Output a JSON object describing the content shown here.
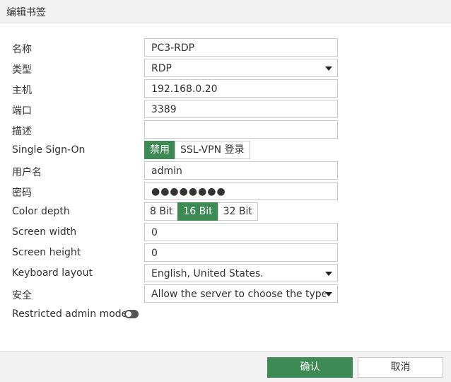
{
  "dialog": {
    "title": "编辑书签"
  },
  "fields": {
    "name": {
      "label": "名称",
      "value": "PC3-RDP"
    },
    "type": {
      "label": "类型",
      "value": "RDP"
    },
    "host": {
      "label": "主机",
      "value": "192.168.0.20"
    },
    "port": {
      "label": "端口",
      "value": "3389"
    },
    "description": {
      "label": "描述",
      "value": ""
    },
    "sso": {
      "label": "Single Sign-On",
      "options": [
        "禁用",
        "SSL-VPN 登录"
      ],
      "selected": "禁用"
    },
    "username": {
      "label": "用户名",
      "value": "admin"
    },
    "password": {
      "label": "密码",
      "value": "●●●●●●●●"
    },
    "color_depth": {
      "label": "Color depth",
      "options": [
        "8 Bit",
        "16 Bit",
        "32 Bit"
      ],
      "selected": "16 Bit"
    },
    "screen_width": {
      "label": "Screen width",
      "value": "0"
    },
    "screen_height": {
      "label": "Screen height",
      "value": "0"
    },
    "keyboard_layout": {
      "label": "Keyboard layout",
      "value": "English, United States."
    },
    "security": {
      "label": "安全",
      "value": "Allow the server to choose the type o"
    },
    "restricted_admin": {
      "label": "Restricted admin mode",
      "enabled": false
    }
  },
  "buttons": {
    "ok": "确认",
    "cancel": "取消"
  },
  "colors": {
    "accent": "#3e8a55",
    "titlebar_bg": "#f2f2f2"
  },
  "icons": {
    "dropdown": "caret-down-icon",
    "toggle": "toggle-switch-icon"
  }
}
